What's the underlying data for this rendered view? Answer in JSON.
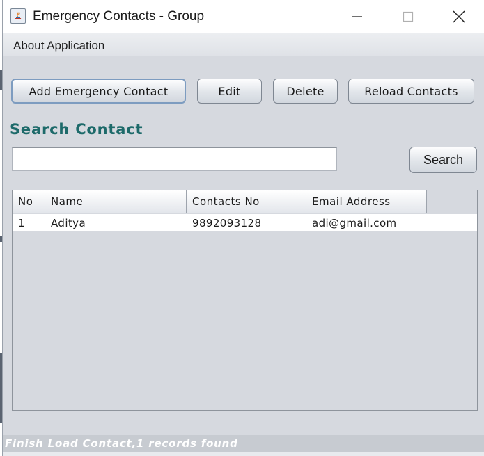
{
  "window": {
    "title": "Emergency Contacts - Group",
    "controls": [
      "minimize",
      "maximize",
      "close"
    ]
  },
  "menubar": {
    "items": [
      {
        "label": "About Application"
      }
    ]
  },
  "toolbar": {
    "add_label": "Add Emergency Contact",
    "edit_label": "Edit",
    "delete_label": "Delete",
    "reload_label": "Reload Contacts"
  },
  "search": {
    "heading": "Search Contact",
    "value": "",
    "button_label": "Search"
  },
  "table": {
    "columns": [
      "No",
      "Name",
      "Contacts No",
      "Email Address"
    ],
    "rows": [
      [
        "1",
        "Aditya",
        "9892093128",
        "adi@gmail.com"
      ]
    ]
  },
  "status": {
    "text": "Finish Load Contact,1 records found"
  },
  "colors": {
    "heading": "#1d6a6a",
    "panel_bg": "#d6d9df",
    "focus_border": "#7d9cc0"
  },
  "icons": [
    "java-app-icon",
    "minimize-icon",
    "maximize-icon",
    "close-icon"
  ]
}
